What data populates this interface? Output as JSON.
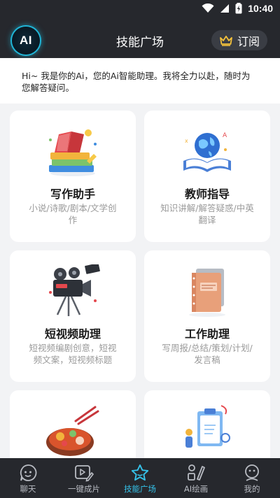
{
  "status_bar": {
    "time": "10:40"
  },
  "header": {
    "logo_text": "AI",
    "title": "技能广场",
    "subscribe_label": "订阅"
  },
  "greeting": "Hi~ 我是你的Ai，您的Ai智能助理。我将全力以赴，随时为您解答疑问。",
  "cards": [
    {
      "title": "写作助手",
      "description": "小说/诗歌/剧本/文学创作"
    },
    {
      "title": "教师指导",
      "description": "知识讲解/解答疑惑/中英翻译"
    },
    {
      "title": "短视频助理",
      "description": "短视频编剧创意，短视频文案，短视频标题"
    },
    {
      "title": "工作助理",
      "description": "写周报/总结/策划/计划/发言稿"
    },
    {
      "title": "",
      "description": ""
    },
    {
      "title": "",
      "description": ""
    }
  ],
  "bottom_nav": [
    {
      "label": "聊天",
      "icon": "chat-face-icon"
    },
    {
      "label": "一键成片",
      "icon": "video-edit-icon"
    },
    {
      "label": "技能广场",
      "icon": "star-icon",
      "active": true
    },
    {
      "label": "AI绘画",
      "icon": "paint-icon"
    },
    {
      "label": "我的",
      "icon": "profile-icon"
    }
  ],
  "colors": {
    "header_bg": "#26282d",
    "accent": "#35c3ea",
    "page_bg": "#f2f3f5"
  }
}
